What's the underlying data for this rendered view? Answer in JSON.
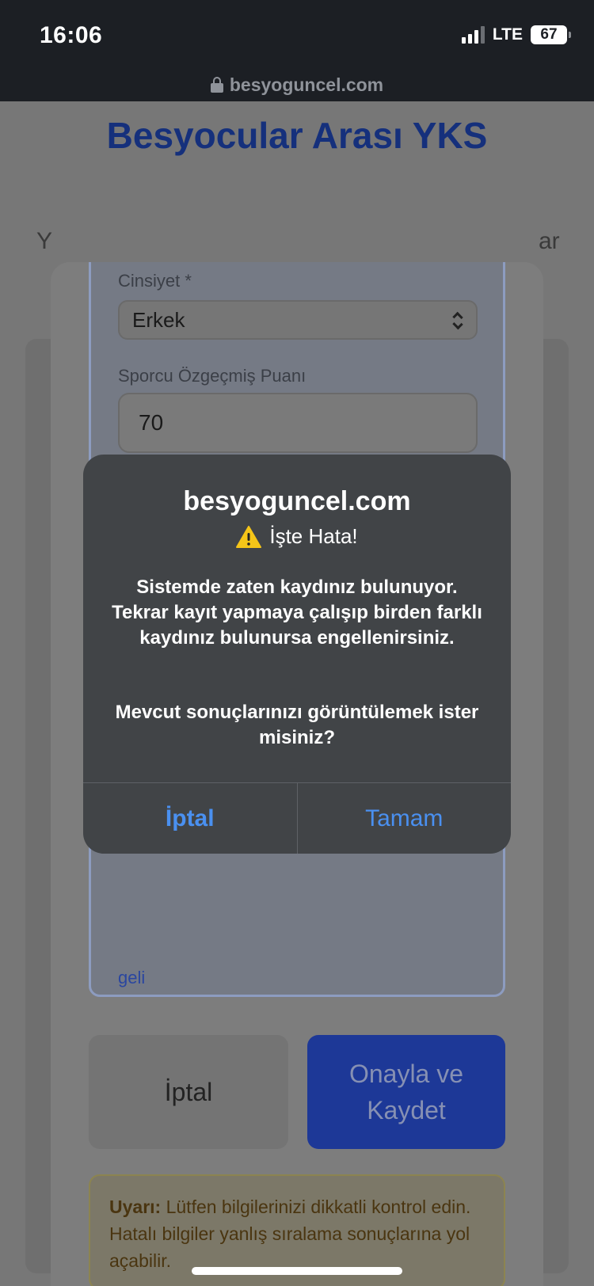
{
  "status_bar": {
    "time": "16:06",
    "network": "LTE",
    "battery": "67"
  },
  "browser": {
    "url": "besyoguncel.com"
  },
  "page": {
    "title": "Besyocular Arası YKS",
    "side_left": "Y",
    "side_right": "ar"
  },
  "form": {
    "gender_label": "Cinsiyet *",
    "gender_value": "Erkek",
    "sports_score_label": "Sporcu Özgeçmiş Puanı",
    "sports_score_value": "70",
    "link_fragment": "geli",
    "cancel_label": "İptal",
    "confirm_label": "Onayla ve Kaydet",
    "warning_bold": "Uyarı:",
    "warning_text": "Lütfen bilgilerinizi dikkatli kontrol edin. Hatalı bilgiler yanlış sıralama sonuçlarına yol açabilir."
  },
  "alert": {
    "title": "besyoguncel.com",
    "subtitle": "İşte Hata!",
    "message": "Sistemde zaten kaydınız bulunuyor. Tekrar kayıt yapmaya çalışıp birden farklı kaydınız bulunursa engellenirsiniz.",
    "question": "Mevcut sonuçlarınızı görüntülemek ister misiniz?",
    "cancel_label": "İptal",
    "ok_label": "Tamam",
    "button_color": "#4a90f0"
  }
}
